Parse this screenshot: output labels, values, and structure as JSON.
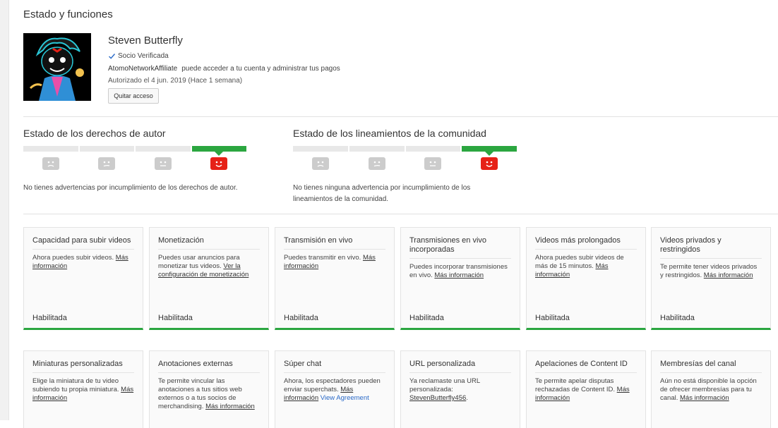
{
  "page": {
    "title": "Estado y funciones"
  },
  "profile": {
    "name": "Steven Butterfly",
    "verified_label": "Socio Verificada",
    "network_name": "AtomoNetworkAffiliate",
    "access_text": "puede acceder a tu cuenta y administrar tus pagos",
    "authorized_text": "Autorizado el 4 jun. 2019 (Hace 1 semana)",
    "remove_button": "Quitar acceso"
  },
  "copyright": {
    "title": "Estado de los derechos de autor",
    "active_index": 3,
    "segments": 4,
    "description": "No tienes advertencias por incumplimiento de los derechos de autor."
  },
  "community": {
    "title": "Estado de los lineamientos de la comunidad",
    "active_index": 3,
    "segments": 4,
    "description_line1": "No tienes ninguna advertencia por incumplimiento de los",
    "description_line2": "lineamientos de la comunidad."
  },
  "colors": {
    "accent_green": "#2ba640",
    "strike_red": "#e62117",
    "inactive_gray": "#cccccc"
  },
  "features_row1": [
    {
      "title": "Capacidad para subir videos",
      "desc": "Ahora puedes subir videos.",
      "link": "Más información",
      "status": "Habilitada"
    },
    {
      "title": "Monetización",
      "desc": "Puedes usar anuncios para monetizar tus videos.",
      "link": "Ver la configuración de monetización",
      "status": "Habilitada"
    },
    {
      "title": "Transmisión en vivo",
      "desc": "Puedes transmitir en vivo.",
      "link": "Más información",
      "status": "Habilitada"
    },
    {
      "title": "Transmisiones en vivo incorporadas",
      "desc": "Puedes incorporar transmisiones en vivo.",
      "link": "Más información",
      "status": "Habilitada"
    },
    {
      "title": "Videos más prolongados",
      "desc": "Ahora puedes subir videos de más de 15 minutos.",
      "link": "Más información",
      "status": "Habilitada"
    },
    {
      "title": "Videos privados y restringidos",
      "desc": "Te permite tener videos privados y restringidos.",
      "link": "Más información",
      "status": "Habilitada"
    }
  ],
  "features_row2": [
    {
      "title": "Miniaturas personalizadas",
      "desc": "Elige la miniatura de tu video subiendo tu propia miniatura.",
      "link": "Más información",
      "extra": ""
    },
    {
      "title": "Anotaciones externas",
      "desc": "Te permite vincular las anotaciones a tus sitios web externos o a tus socios de merchandising.",
      "link": "Más información",
      "extra": ""
    },
    {
      "title": "Súper chat",
      "desc": "Ahora, los espectadores pueden enviar superchats.",
      "link": "Más información",
      "extra": "View Agreement"
    },
    {
      "title": "URL personalizada",
      "desc": "Ya reclamaste una URL personalizada:",
      "link": "StevenButterfly456",
      "extra": "."
    },
    {
      "title": "Apelaciones de Content ID",
      "desc": "Te permite apelar disputas rechazadas de Content ID.",
      "link": "Más información",
      "extra": ""
    },
    {
      "title": "Membresías del canal",
      "desc": "Aún no está disponible la opción de ofrecer membresías para tu canal.",
      "link": "Más información",
      "extra": ""
    }
  ]
}
